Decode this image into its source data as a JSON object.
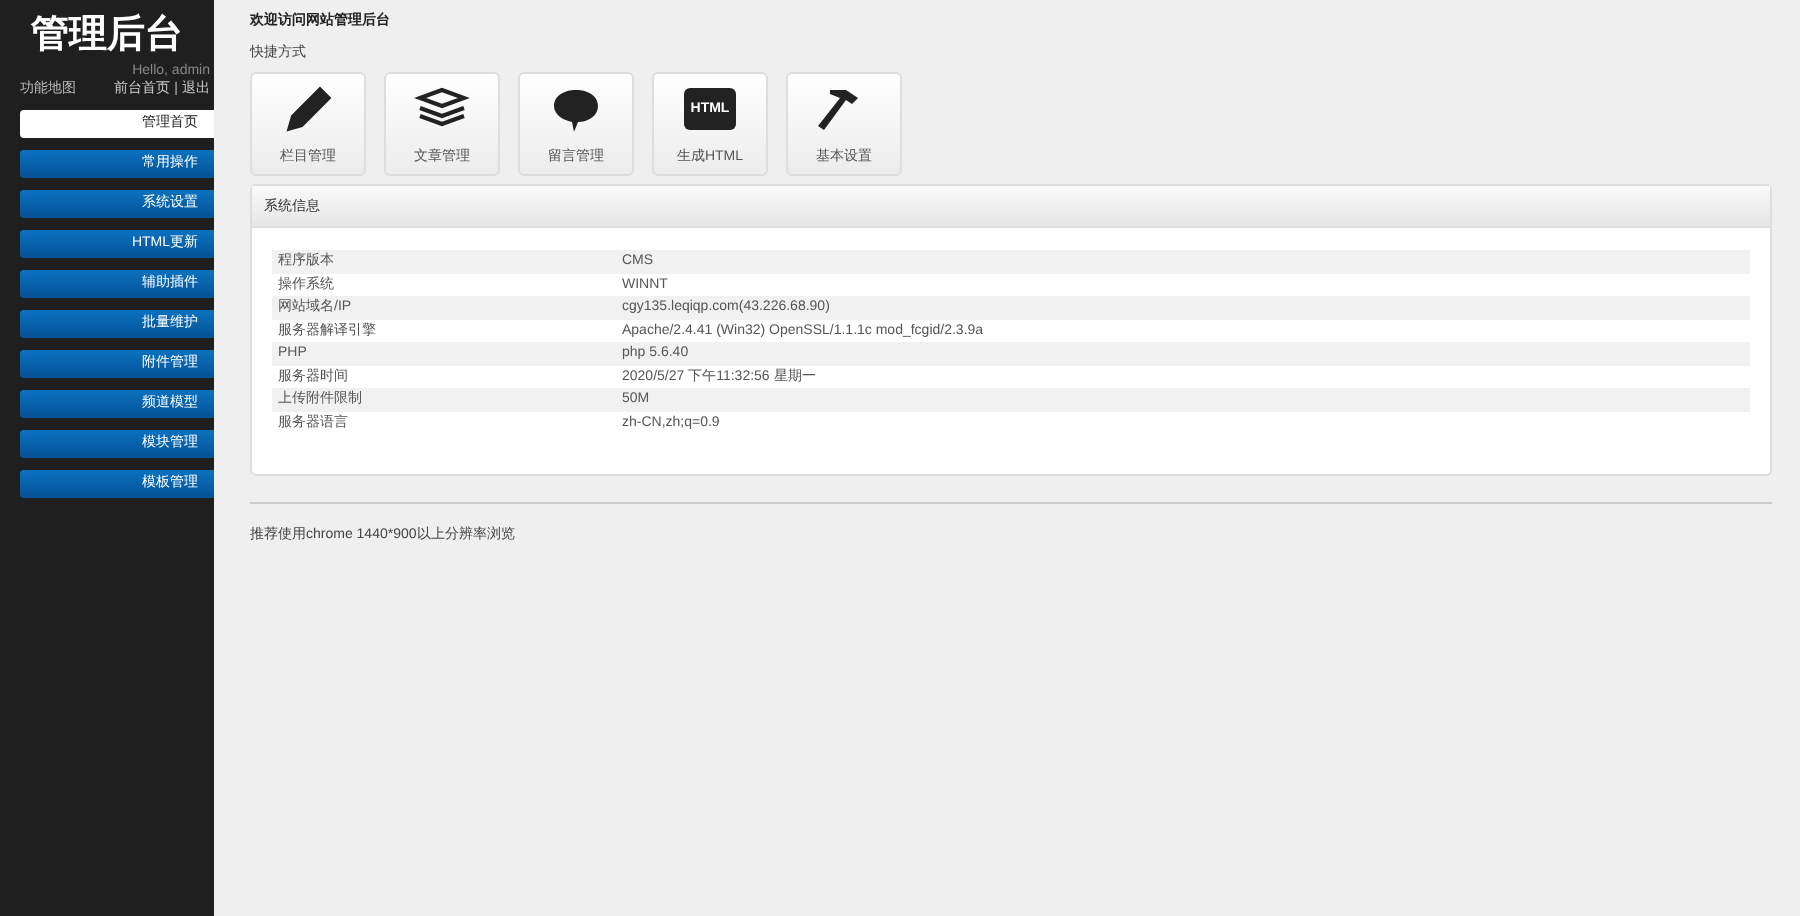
{
  "sidebar": {
    "logo": "管理后台",
    "greeting": "Hello, admin",
    "map_link": "功能地图",
    "links": [
      "前台首页",
      "退出"
    ],
    "link_separator": "|",
    "items": [
      {
        "label": "管理首页",
        "selected": true
      },
      {
        "label": "常用操作",
        "selected": false
      },
      {
        "label": "系统设置",
        "selected": false
      },
      {
        "label": "HTML更新",
        "selected": false
      },
      {
        "label": "辅助插件",
        "selected": false
      },
      {
        "label": "批量维护",
        "selected": false
      },
      {
        "label": "附件管理",
        "selected": false
      },
      {
        "label": "频道模型",
        "selected": false
      },
      {
        "label": "模块管理",
        "selected": false
      },
      {
        "label": "模板管理",
        "selected": false
      }
    ]
  },
  "main": {
    "welcome": "欢迎访问网站管理后台",
    "shortcuts_title": "快捷方式",
    "shortcuts": [
      {
        "kind": "pencil",
        "label": "栏目管理"
      },
      {
        "kind": "papers",
        "label": "文章管理"
      },
      {
        "kind": "bubble",
        "label": "留言管理"
      },
      {
        "kind": "html",
        "icon_text": "HTML",
        "label": "生成HTML"
      },
      {
        "kind": "hammer",
        "label": "基本设置"
      }
    ],
    "panel": {
      "title": "系统信息",
      "rows": [
        {
          "label": "程序版本",
          "value": "CMS"
        },
        {
          "label": "操作系统",
          "value": "WINNT"
        },
        {
          "label": "网站域名/IP",
          "value": "cgy135.leqiqp.com(43.226.68.90)"
        },
        {
          "label": "服务器解译引擎",
          "value": "Apache/2.4.41 (Win32) OpenSSL/1.1.1c mod_fcgid/2.3.9a"
        },
        {
          "label": "PHP",
          "value": "php 5.6.40"
        },
        {
          "label": "服务器时间",
          "value": "2020/5/27 下午11:32:56 星期一"
        },
        {
          "label": "上传附件限制",
          "value": "50M"
        },
        {
          "label": "服务器语言",
          "value": "zh-CN,zh;q=0.9"
        }
      ]
    },
    "footer": "推荐使用chrome 1440*900以上分辨率浏览"
  }
}
